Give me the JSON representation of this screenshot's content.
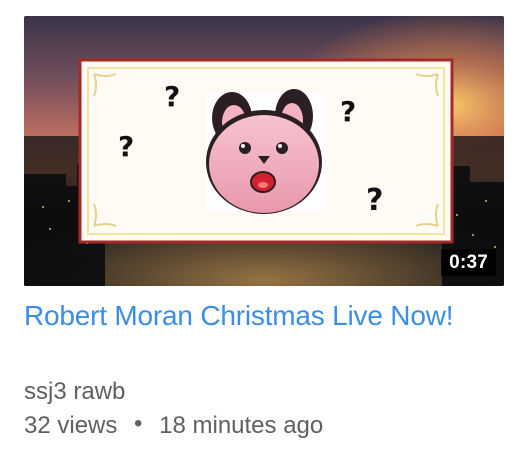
{
  "video": {
    "duration": "0:37",
    "title": "Robert Moran Christmas Live Now!",
    "channel": "ssj3 rawb",
    "views": "32 views",
    "separator": "•",
    "uploaded": "18 minutes ago"
  },
  "thumbnail": {
    "question_marks": [
      "?",
      "?",
      "?",
      "?"
    ],
    "icons": [
      "city-skyline",
      "question-mark",
      "pink-creature-face"
    ]
  },
  "colors": {
    "title": "#3b8de5",
    "meta": "#606060",
    "duration_badge": "#000000",
    "panel_border": "#a42a2a",
    "creature": "#f0a4b5"
  }
}
